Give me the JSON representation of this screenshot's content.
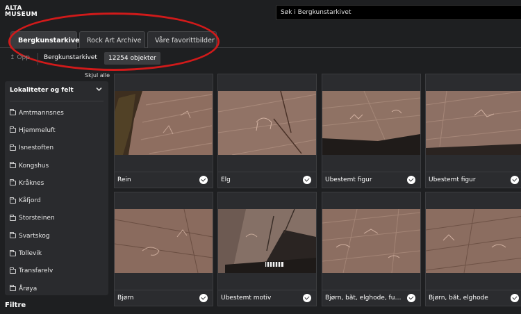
{
  "header": {
    "logo_line1": "ALTA",
    "logo_line2": "MUSEUM",
    "search_placeholder": "Søk i Bergkunstarkivet"
  },
  "tabs": [
    {
      "label": "Bergkunstarkivet",
      "active": true
    },
    {
      "label": "Rock Art Archive",
      "active": false
    },
    {
      "label": "Våre favorittbilder",
      "active": false
    }
  ],
  "breadcrumb": {
    "up_label": "↥ Opp",
    "current": "Bergkunstarkivet",
    "count": "12254 objekter"
  },
  "sidebar": {
    "hide_all": "Skjul alle",
    "heading": "Lokaliteter og felt",
    "items": [
      {
        "label": "Amtmannsnes"
      },
      {
        "label": "Hjemmeluft"
      },
      {
        "label": "Isnestoften"
      },
      {
        "label": "Kongshus"
      },
      {
        "label": "Kråknes"
      },
      {
        "label": "Kåfjord"
      },
      {
        "label": "Storsteinen"
      },
      {
        "label": "Svartskog"
      },
      {
        "label": "Tollevik"
      },
      {
        "label": "Transfarelv"
      },
      {
        "label": "Årøya"
      }
    ],
    "filters_label": "Filtre"
  },
  "grid": {
    "items": [
      {
        "caption": "Rein"
      },
      {
        "caption": "Elg"
      },
      {
        "caption": "Ubestemt figur"
      },
      {
        "caption": "Ubestemt figur"
      },
      {
        "caption": "Bjørn"
      },
      {
        "caption": "Ubestemt motiv"
      },
      {
        "caption": "Bjørn, båt, elghode, fug..."
      },
      {
        "caption": "Bjørn, båt, elghode"
      }
    ]
  },
  "colors": {
    "accent": "#d11a1a",
    "rock": "#8a6a5c",
    "background": "#1e1f21"
  }
}
